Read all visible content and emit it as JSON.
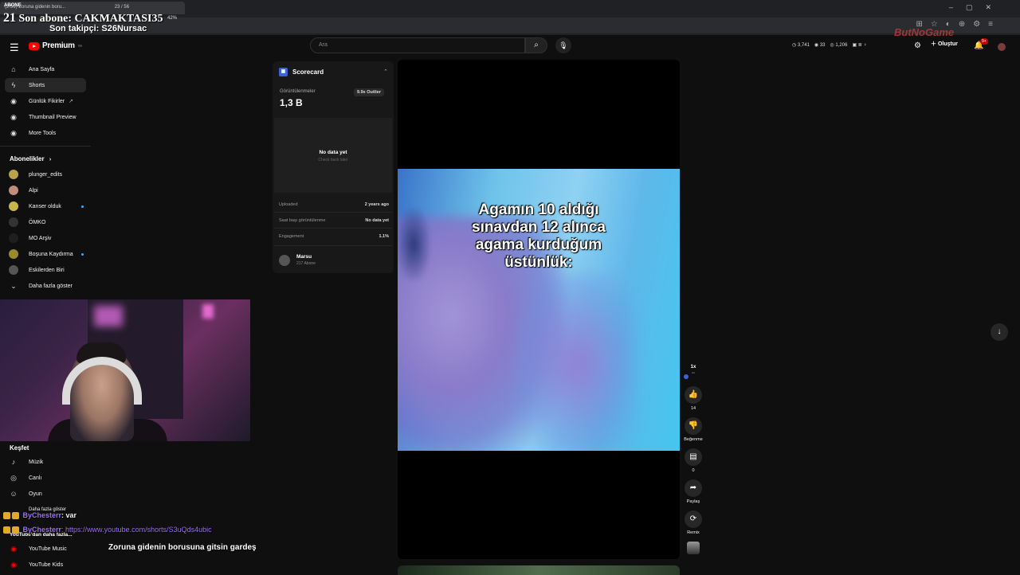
{
  "browser": {
    "tab_title": "(2:59) Zoruna gidenin boru...",
    "tab_counter": "23 / 56",
    "window_controls": [
      "–",
      "▢",
      "✕"
    ]
  },
  "overlay": {
    "abone_tag": "ABONE",
    "abone_line_num": "21",
    "abone_line_text": "Son abone: CAKMAKTASI35",
    "percent": "42%",
    "follow_line": "Son takipçi: S26Nursac",
    "watermark": "ButNoGame"
  },
  "header": {
    "logo_text": "Premium",
    "logo_sup": "TR",
    "search_placeholder": "Ara",
    "stats": [
      "3,741",
      "33",
      "1,206"
    ],
    "create_label": "Oluştur",
    "notif_badge": "9+"
  },
  "sidebar": {
    "main": [
      {
        "label": "Ana Sayfa",
        "icon": "home-icon",
        "glyph": "⌂"
      },
      {
        "label": "Shorts",
        "icon": "shorts-icon",
        "glyph": "ϟ"
      },
      {
        "label": "Günlük Fikirler",
        "icon": "bulb-icon",
        "glyph": "◉"
      },
      {
        "label": "Thumbnail Preview",
        "icon": "thumbnail-icon",
        "glyph": "◉"
      },
      {
        "label": "More Tools",
        "icon": "tools-icon",
        "glyph": "◉"
      }
    ],
    "subs_header": "Abonelikler",
    "subs": [
      {
        "label": "plunger_edits",
        "color": "#b5a24a",
        "new": false
      },
      {
        "label": "Alpi",
        "color": "#c28c7d",
        "new": false
      },
      {
        "label": "Kanser olduk",
        "color": "#c6b64a",
        "new": true
      },
      {
        "label": "ÖMKO",
        "color": "#333333",
        "new": false
      },
      {
        "label": "MO Arşiv",
        "color": "#1f1f1f",
        "new": false
      },
      {
        "label": "Boşuna Kaydırma",
        "color": "#9a8a2a",
        "new": true
      },
      {
        "label": "Eskilerden Biri",
        "color": "#555555",
        "new": false
      }
    ],
    "more_label": "Daha fazla göster",
    "explore_header": "Keşfet",
    "explore": [
      {
        "label": "Müzik",
        "icon": "music-icon",
        "glyph": "♪"
      },
      {
        "label": "Canlı",
        "icon": "live-icon",
        "glyph": "◎"
      },
      {
        "label": "Oyun",
        "icon": "gaming-icon",
        "glyph": "☺"
      }
    ],
    "explore_more": "Daha fazla göster",
    "more_from_header": "YouTube'dan daha fazla...",
    "more_from": [
      {
        "label": "YouTube Music",
        "icon": "yt-music-icon"
      },
      {
        "label": "YouTube Kids",
        "icon": "yt-kids-icon"
      }
    ]
  },
  "scorecard": {
    "title": "Scorecard",
    "views_label": "Görüntülenmeler",
    "views": "1,3 B",
    "outlier": "9.9x Outlier",
    "nodata": "No data yet",
    "nodata_sub": "Check back later",
    "rows": [
      {
        "label": "Uploaded",
        "value": "2 years ago"
      },
      {
        "label": "Saat başı görüntülenme",
        "value": "No data yet"
      },
      {
        "label": "Engagement",
        "value": "1.1%"
      }
    ],
    "channel_name": "Marsu",
    "channel_subs": "217 Abone"
  },
  "video": {
    "caption_lines": [
      "Agamın 10 aldığı",
      "sınavdan 12 alınca",
      "agama kurduğum",
      "üstünlük:"
    ]
  },
  "actions": {
    "speed": "1x",
    "speed_sub": "hız",
    "likes": "14",
    "dislike_label": "Beğenme",
    "comments": "0",
    "share_label": "Paylaş",
    "remix_label": "Remix"
  },
  "chat": {
    "line1_user": "ByChesterr",
    "line1_msg": ": var",
    "line2_user": "ByChesterr",
    "line2_msg": ": https://www.youtube.com/shorts/S3uQds4ubic",
    "ticker": "Zoruna gidenin borusuna gitsin gardeş"
  }
}
